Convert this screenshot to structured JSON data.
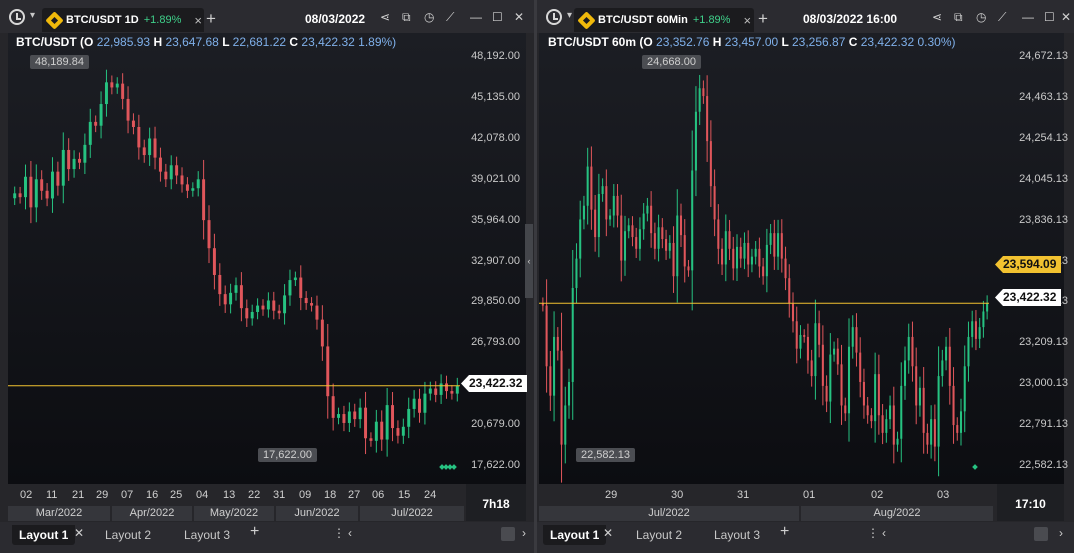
{
  "left": {
    "tab_title": "BTC/USDT 1D",
    "tab_change": "+1.89%",
    "date": "08/03/2022",
    "ohlc": {
      "symbol": "BTC/USDT",
      "o_label": "(O",
      "o": "22,985.93",
      "h_label": "H",
      "h": "23,647.68",
      "l_label": "L",
      "l": "22,681.22",
      "c_label": "C",
      "c": "23,422.32",
      "pct": "1.89%)"
    },
    "price_axis": [
      "48,192.00",
      "45,135.00",
      "42,078.00",
      "39,021.00",
      "35,964.00",
      "32,907.00",
      "29,850.00",
      "26,793.00",
      "23,736.00",
      "20,679.00",
      "17,622.00"
    ],
    "last_price": "23,422.32",
    "high_marker": "48,189.84",
    "low_marker": "17,622.00",
    "x_ticks": [
      "02",
      "11",
      "21",
      "29",
      "07",
      "16",
      "25",
      "04",
      "13",
      "22",
      "31",
      "09",
      "18",
      "27",
      "06",
      "15",
      "24"
    ],
    "months": [
      "Mar/2022",
      "Apr/2022",
      "May/2022",
      "Jun/2022",
      "Jul/2022"
    ],
    "timer": "7h18",
    "layouts": [
      "Layout 1",
      "Layout 2",
      "Layout 3"
    ],
    "chart_data": {
      "type": "candlestick",
      "ylim": [
        16500,
        49500
      ],
      "closes": [
        38500,
        38200,
        39800,
        37400,
        39600,
        38700,
        38100,
        40200,
        39100,
        41900,
        40400,
        41200,
        40900,
        42300,
        44100,
        43800,
        45500,
        47200,
        46800,
        47100,
        45900,
        44200,
        43700,
        42100,
        41500,
        42800,
        41300,
        40200,
        39600,
        40700,
        39900,
        39200,
        38700,
        38900,
        39600,
        36400,
        34200,
        32100,
        30600,
        29800,
        30700,
        31300,
        29500,
        28700,
        29200,
        29700,
        29400,
        30100,
        29300,
        29100,
        30500,
        31700,
        31900,
        30300,
        29900,
        29700,
        28600,
        26500,
        22600,
        20900,
        21200,
        20500,
        21400,
        20800,
        21700,
        19300,
        19100,
        20600,
        19200,
        21900,
        20100,
        19500,
        20200,
        21600,
        22400,
        21300,
        22800,
        23200,
        22700,
        23600,
        23000,
        22800,
        23422
      ],
      "colors": {
        "up": "#26c281",
        "down": "#e0565b",
        "last_line": "#f2c230"
      }
    }
  },
  "right": {
    "tab_title": "BTC/USDT 60Min",
    "tab_change": "+1.89%",
    "date": "08/03/2022 16:00",
    "ohlc": {
      "symbol": "BTC/USDT 60m",
      "o_label": "(O",
      "o": "23,352.76",
      "h_label": "H",
      "h": "23,457.00",
      "l_label": "L",
      "l": "23,256.87",
      "c_label": "C",
      "c": "23,422.32",
      "pct": "0.30%)"
    },
    "price_axis": [
      "24,672.13",
      "24,463.13",
      "24,254.13",
      "24,045.13",
      "23,836.13",
      "23,627.13",
      "23,418.13",
      "23,209.13",
      "23,000.13",
      "22,791.13",
      "22,582.13"
    ],
    "last_price": "23,422.32",
    "highlight_price": "23,594.09",
    "high_marker": "24,668.00",
    "low_marker": "22,582.13",
    "x_ticks": [
      "29",
      "30",
      "31",
      "01",
      "02",
      "03"
    ],
    "months": [
      "Jul/2022",
      "Aug/2022"
    ],
    "timer": "17:10",
    "layouts": [
      "Layout 1",
      "Layout 2",
      "Layout 3"
    ],
    "chart_data": {
      "type": "candlestick",
      "ylim": [
        22550,
        24700
      ],
      "closes": [
        23410,
        23100,
        22950,
        23250,
        23180,
        22700,
        22900,
        23020,
        23500,
        23650,
        23850,
        23920,
        24120,
        23900,
        23760,
        23980,
        24020,
        23850,
        23870,
        23970,
        23870,
        23640,
        23790,
        23820,
        23760,
        23700,
        23800,
        23880,
        23920,
        23780,
        23700,
        23810,
        23750,
        23690,
        23730,
        23560,
        23870,
        23770,
        23610,
        23590,
        24100,
        24400,
        24520,
        24480,
        24250,
        24020,
        23850,
        23700,
        23620,
        23790,
        23700,
        23600,
        23710,
        23650,
        23730,
        23620,
        23660,
        23700,
        23610,
        23560,
        23720,
        23780,
        23660,
        23780,
        23650,
        23550,
        23420,
        23330,
        23190,
        23260,
        23250,
        23130,
        23050,
        23320,
        23210,
        23000,
        22920,
        23160,
        23190,
        23110,
        22900,
        22860,
        23200,
        23300,
        23170,
        23020,
        22900,
        22850,
        22820,
        23060,
        22850,
        22760,
        22830,
        22900,
        22700,
        22730,
        23000,
        23130,
        23250,
        23100,
        22900,
        22990,
        22760,
        22700,
        22830,
        22690,
        23050,
        23130,
        23200,
        23000,
        22800,
        22760,
        22870,
        23100,
        23250,
        23330,
        23240,
        23300,
        23380,
        23422
      ],
      "colors": {
        "up": "#26c281",
        "down": "#e0565b",
        "last_line": "#f2c230"
      }
    }
  }
}
